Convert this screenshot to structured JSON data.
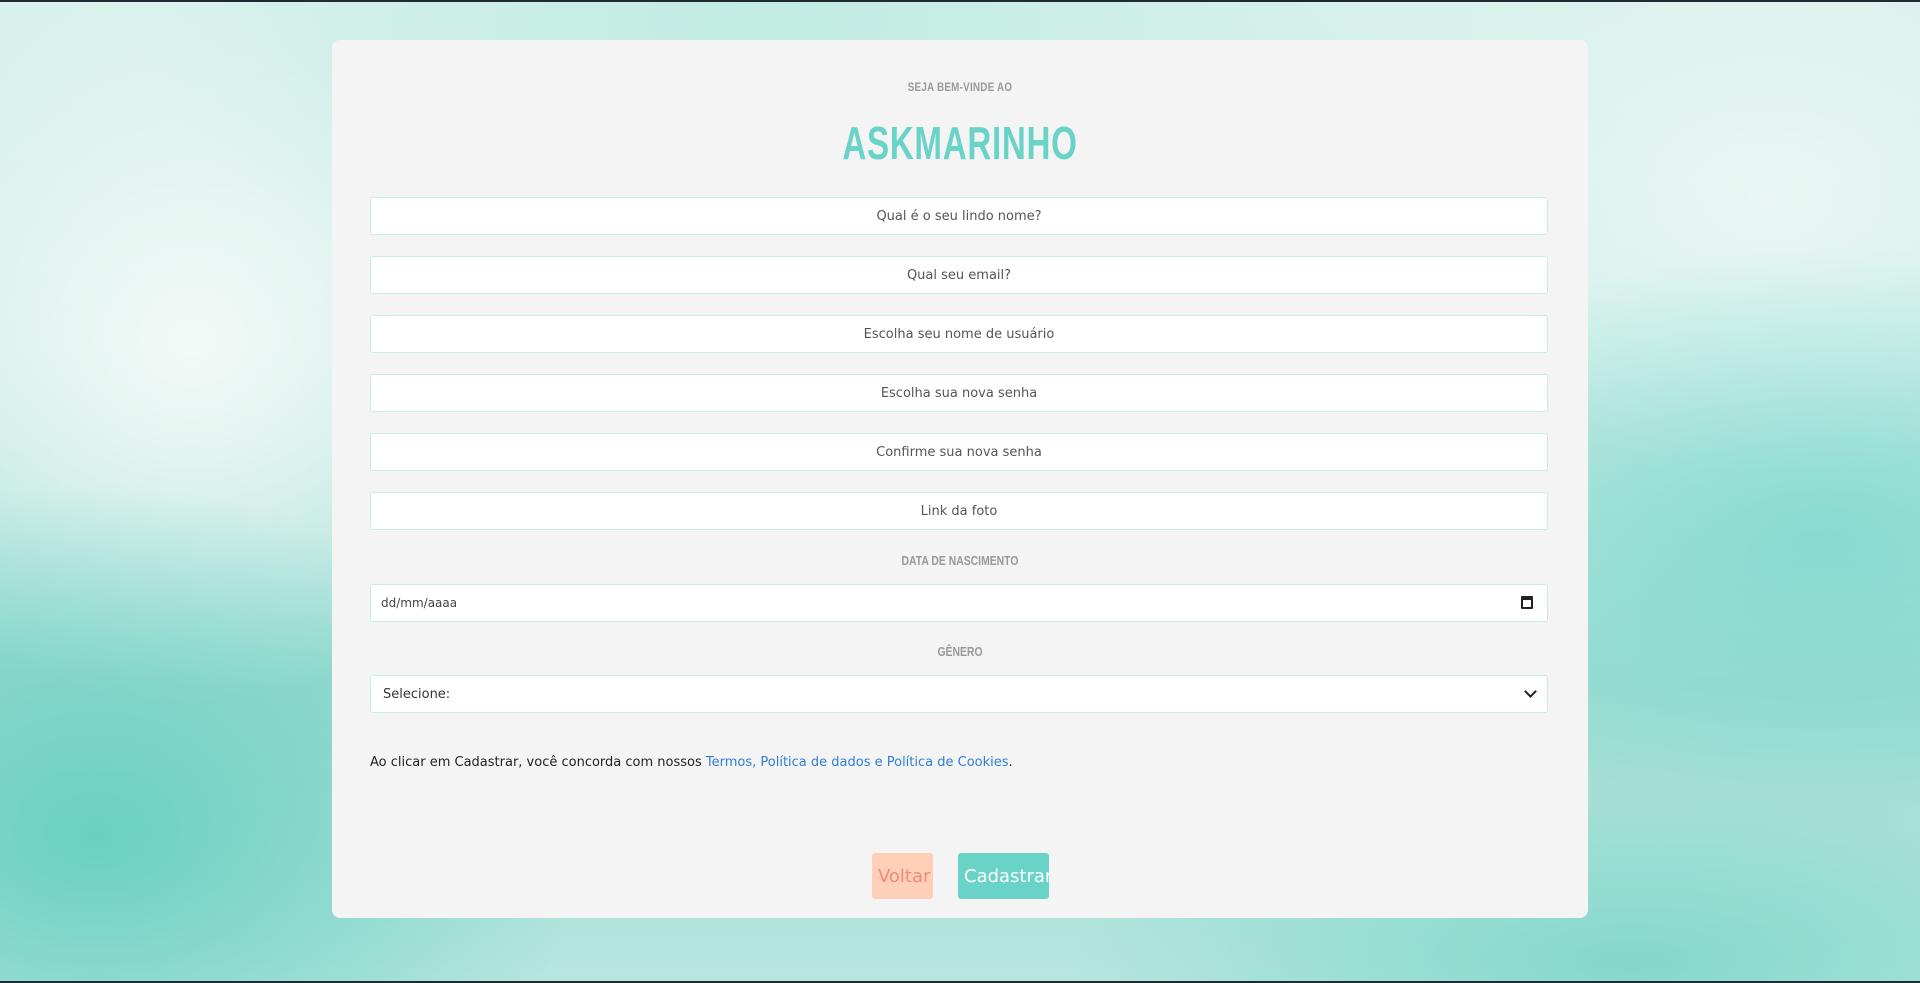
{
  "header": {
    "welcome": "SEJA BEM-VINDE AO",
    "brand": "ASKMARINHO"
  },
  "form": {
    "name_placeholder": "Qual é o seu lindo nome?",
    "email_placeholder": "Qual seu email?",
    "username_placeholder": "Escolha seu nome de usuário",
    "password_placeholder": "Escolha sua nova senha",
    "confirm_password_placeholder": "Confirme sua nova senha",
    "photo_placeholder": "Link da foto",
    "birthdate_label": "DATA DE NASCIMENTO",
    "birthdate_placeholder": "dd/mm/aaaa",
    "gender_label": "GÊNERO",
    "gender_selected": "Selecione:"
  },
  "terms": {
    "text": "Ao clicar em Cadastrar, você concorda com nossos ",
    "link": "Termos, Política de dados e Política de Cookies",
    "suffix": "."
  },
  "buttons": {
    "back": "Voltar",
    "submit": "Cadastrar"
  },
  "colors": {
    "brand": "#6ad3c8",
    "back_button_bg": "#ffcfb8",
    "back_button_text": "#f08a7a",
    "link": "#2f7fd6"
  }
}
